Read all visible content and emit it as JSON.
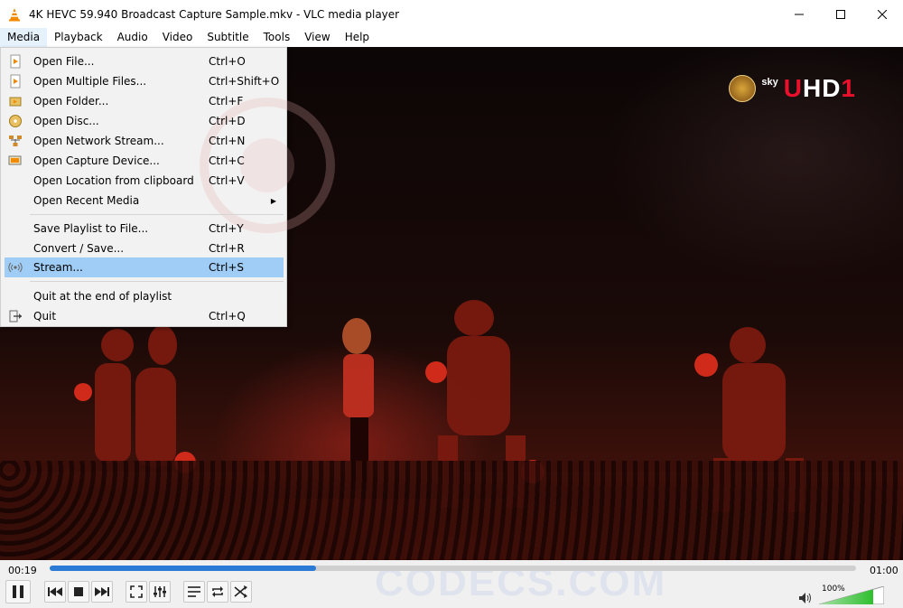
{
  "window": {
    "title": "4K HEVC 59.940 Broadcast Capture Sample.mkv - VLC media player",
    "app_icon": "vlc-cone-icon",
    "controls": [
      "minimize-icon",
      "maximize-icon",
      "close-icon"
    ]
  },
  "menubar": {
    "items": [
      "Media",
      "Playback",
      "Audio",
      "Video",
      "Subtitle",
      "Tools",
      "View",
      "Help"
    ],
    "active": "Media"
  },
  "media_menu": {
    "items": [
      {
        "label": "Open File...",
        "shortcut": "Ctrl+O",
        "icon": "open-file-icon"
      },
      {
        "label": "Open Multiple Files...",
        "shortcut": "Ctrl+Shift+O",
        "icon": "open-multiple-files-icon"
      },
      {
        "label": "Open Folder...",
        "shortcut": "Ctrl+F",
        "icon": "folder-icon"
      },
      {
        "label": "Open Disc...",
        "shortcut": "Ctrl+D",
        "icon": "disc-icon"
      },
      {
        "label": "Open Network Stream...",
        "shortcut": "Ctrl+N",
        "icon": "network-icon"
      },
      {
        "label": "Open Capture Device...",
        "shortcut": "Ctrl+C",
        "icon": "capture-device-icon"
      },
      {
        "label": "Open Location from clipboard",
        "shortcut": "Ctrl+V",
        "icon": ""
      },
      {
        "label": "Open Recent Media",
        "shortcut": "",
        "icon": "",
        "submenu": true
      },
      {
        "label": "Save Playlist to File...",
        "shortcut": "Ctrl+Y",
        "icon": ""
      },
      {
        "label": "Convert / Save...",
        "shortcut": "Ctrl+R",
        "icon": ""
      },
      {
        "label": "Stream...",
        "shortcut": "Ctrl+S",
        "icon": "stream-icon",
        "highlighted": true
      },
      {
        "label": "Quit at the end of playlist",
        "shortcut": "",
        "icon": ""
      },
      {
        "label": "Quit",
        "shortcut": "Ctrl+Q",
        "icon": "quit-icon"
      }
    ]
  },
  "video": {
    "channel_logo": {
      "sky": "sky",
      "uhd_prefix": "U",
      "uhd_rest": "HD",
      "uhd_num": "1"
    }
  },
  "playback": {
    "elapsed": "00:19",
    "total": "01:00",
    "progress_percent": 33
  },
  "watermark": "CODECS.COM",
  "volume": {
    "label": "100%",
    "level_percent": 100
  },
  "colors": {
    "accent": "#2b7bd6",
    "menu_highlight": "#9fcdf5",
    "volume_green": "#3cc43c",
    "uhd_red": "#e8102a"
  }
}
